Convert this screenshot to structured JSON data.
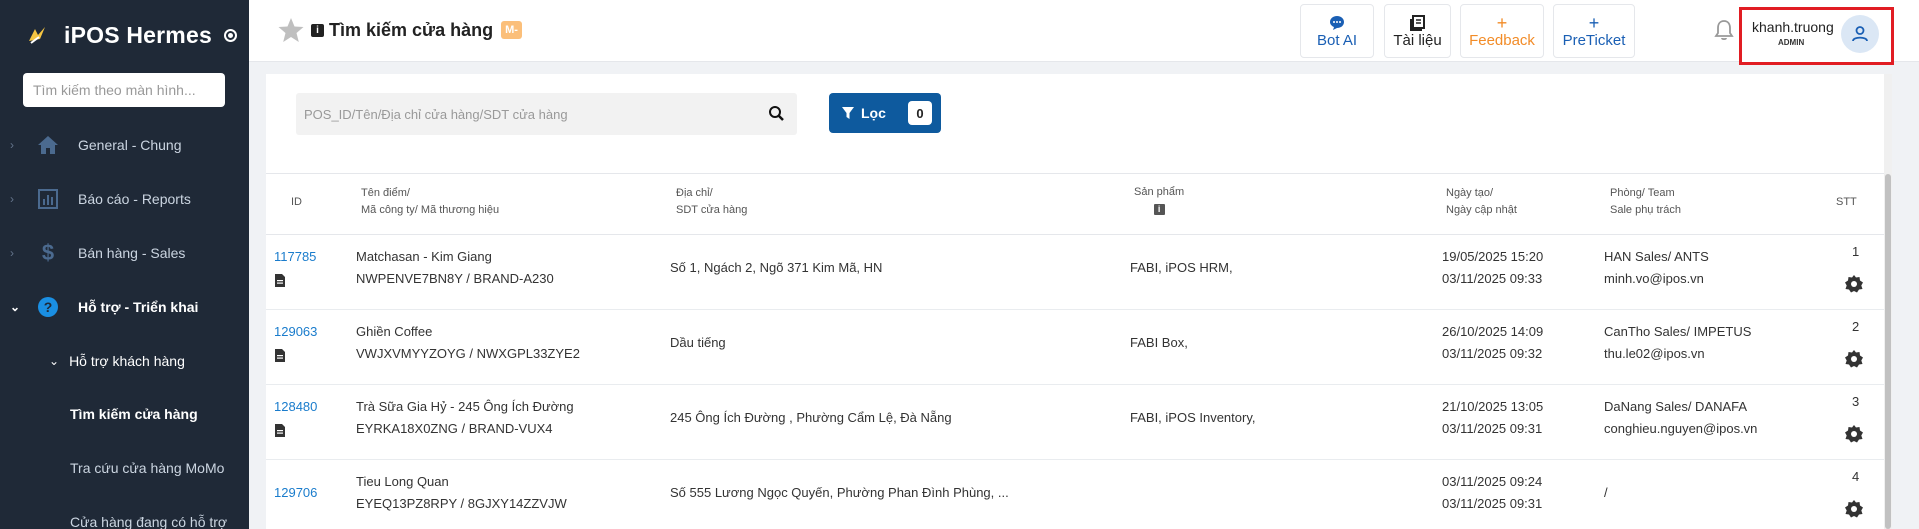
{
  "app": {
    "title": "iPOS Hermes"
  },
  "sidebar": {
    "search_placeholder": "Tìm kiếm theo màn hình...",
    "items": [
      {
        "label": "General - Chung",
        "icon": "home-icon"
      },
      {
        "label": "Báo cáo - Reports",
        "icon": "bar-chart-icon"
      },
      {
        "label": "Bán hàng - Sales",
        "icon": "dollar-icon"
      },
      {
        "label": "Hỗ trợ - Triển khai",
        "icon": "help-circle-icon"
      }
    ],
    "subgroup": "Hỗ trợ khách hàng",
    "subitems": [
      {
        "label": "Tìm kiếm cửa hàng"
      },
      {
        "label": "Tra cứu cửa hàng MoMo"
      },
      {
        "label": "Cửa hàng đang có hỗ trợ"
      }
    ]
  },
  "header": {
    "title": "Tìm kiếm cửa hàng",
    "info_badge": "i",
    "badge": "M-",
    "buttons": [
      {
        "label": "Bot AI",
        "icon": "chat-icon",
        "color": "#1a5fb4"
      },
      {
        "label": "Tài liệu",
        "icon": "book-icon",
        "color": "#222222"
      },
      {
        "label": "Feedback",
        "icon": "plus-icon",
        "color": "#f28c28"
      },
      {
        "label": "PreTicket",
        "icon": "plus-icon",
        "color": "#1a5fb4"
      }
    ],
    "user": {
      "name": "khanh.truong",
      "role": "ADMIN"
    }
  },
  "search": {
    "placeholder": "POS_ID/Tên/Địa chỉ cửa hàng/SDT cửa hàng",
    "filter_label": "Lọc",
    "filter_count": "0"
  },
  "table": {
    "headers": {
      "id": "ID",
      "name_1": "Tên điểm/",
      "name_2": "Mã công ty/ Mã thương hiệu",
      "addr_1": "Địa chỉ/",
      "addr_2": "SDT cửa hàng",
      "product": "Sản phẩm",
      "product_info": "i",
      "date_1": "Ngày tạo/",
      "date_2": "Ngày cập nhật",
      "team_1": "Phòng/ Team",
      "team_2": "Sale phụ trách",
      "stt": "STT"
    },
    "rows": [
      {
        "id": "117785",
        "name": "Matchasan - Kim Giang",
        "codes": "NWPENVE7BN8Y / BRAND-A230",
        "address": "Số 1, Ngách 2, Ngõ 371 Kim Mã, HN",
        "products": "FABI,  iPOS HRM,",
        "created": "19/05/2025 15:20",
        "updated": "03/11/2025 09:33",
        "team": "HAN Sales/ ANTS",
        "sale": "minh.vo@ipos.vn",
        "stt": "1"
      },
      {
        "id": "129063",
        "name": "Ghiền Coffee",
        "codes": "VWJXVMYYZOYG / NWXGPL33ZYE2",
        "address": "Dầu tiếng",
        "products": "FABI Box,",
        "created": "26/10/2025 14:09",
        "updated": "03/11/2025 09:32",
        "team": "CanTho Sales/ IMPETUS",
        "sale": "thu.le02@ipos.vn",
        "stt": "2"
      },
      {
        "id": "128480",
        "name": "Trà Sữa Gia Hỷ - 245 Ông Ích Đường",
        "codes": "EYRKA18X0ZNG / BRAND-VUX4",
        "address": "245 Ông Ích Đường , Phường Cẩm Lệ, Đà Nẵng",
        "products": "FABI,  iPOS Inventory,",
        "created": "21/10/2025 13:05",
        "updated": "03/11/2025 09:31",
        "team": "DaNang Sales/ DANAFA",
        "sale": "conghieu.nguyen@ipos.vn",
        "stt": "3"
      },
      {
        "id": "129706",
        "name": "Tieu Long Quan",
        "codes": "EYEQ13PZ8RPY / 8GJXY14ZZVJW",
        "address": "Số 555 Lương Ngọc Quyến, Phường Phan Đình Phùng, ...",
        "products": "",
        "created": "03/11/2025 09:24",
        "updated": "03/11/2025 09:31",
        "team": "/",
        "sale": "",
        "stt": "4"
      }
    ]
  },
  "colors": {
    "sidebar_bg": "#1f2937",
    "accent": "#0e5a9e",
    "link": "#1a7ccc",
    "highlight_border": "#e11d23"
  }
}
